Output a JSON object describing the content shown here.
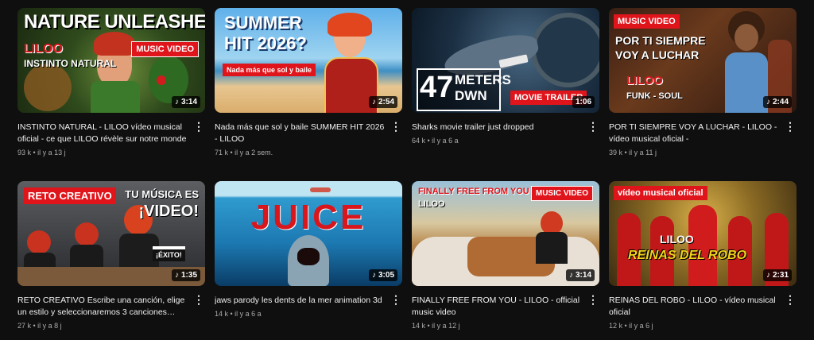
{
  "videos": [
    {
      "title": "INSTINTO NATURAL - LILOO vídeo musical oficial - ce que LILOO révèle sur notre monde",
      "stats": "93 k • il y a 13 j",
      "duration": "3:14",
      "overlay": {
        "headline": "NATURE UNLEASHED",
        "name": "LILOO",
        "sub": "INSTINTO NATURAL",
        "badge": "MUSIC VIDEO"
      }
    },
    {
      "title": "Nada más que sol y baile SUMMER HIT 2026 - LILOO",
      "stats": "71 k • il y a 2 sem.",
      "duration": "2:54",
      "overlay": {
        "line1": "SUMMER",
        "line2": "HIT 2026?",
        "tag": "Nada más que sol y baile"
      }
    },
    {
      "title": "Sharks movie trailer just dropped",
      "stats": "64 k • il y a 6 a",
      "duration": "1:06",
      "overlay": {
        "big": "47",
        "line1": "METERS",
        "line2": "DWN",
        "badge": "MOVIE TRAILER"
      }
    },
    {
      "title": "POR TI SIEMPRE VOY A LUCHAR - LILOO - vídeo musical oficial -",
      "stats": "39 k • il y a 11 j",
      "duration": "2:44",
      "overlay": {
        "badge": "MUSIC VIDEO",
        "line1": "POR TI SIEMPRE",
        "line2": "VOY A LUCHAR",
        "name": "LILOO",
        "genre": "FUNK - SOUL"
      }
    },
    {
      "title": "RETO CREATIVO Escribe una canción, elige un estilo y seleccionaremos 3 canciones…",
      "stats": "27 k • il y a 8 j",
      "duration": "1:35",
      "overlay": {
        "badge": "RETO CREATIVO",
        "line1": "TU MÚSICA ES",
        "line2": "¡VIDEO!",
        "clap": "¡ÉXITO!"
      }
    },
    {
      "title": "jaws parody les dents de la mer animation 3d",
      "stats": "14 k • il y a 6 a",
      "duration": "3:05",
      "overlay": {
        "word": "JUICE"
      }
    },
    {
      "title": "FINALLY FREE FROM YOU - LILOO - official music video",
      "stats": "14 k • il y a 12 j",
      "duration": "3:14",
      "overlay": {
        "line1": "FINALLY FREE FROM YOU",
        "name": "LILOO",
        "badge": "MUSIC VIDEO"
      }
    },
    {
      "title": "REINAS DEL ROBO - LILOO - vídeo musical oficial",
      "stats": "12 k • il y a 6 j",
      "duration": "2:31",
      "overlay": {
        "badge": "vídeo musical oficial",
        "name": "LILOO",
        "line1": "REINAS DEL ROBO"
      }
    }
  ],
  "icons": {
    "duration": "music-note-icon",
    "menu": "more-vert-icon"
  },
  "colors": {
    "background": "#0f0f0f",
    "accent_red": "#e0141b",
    "text": "#f1f1f1",
    "muted": "#aaaaaa"
  }
}
